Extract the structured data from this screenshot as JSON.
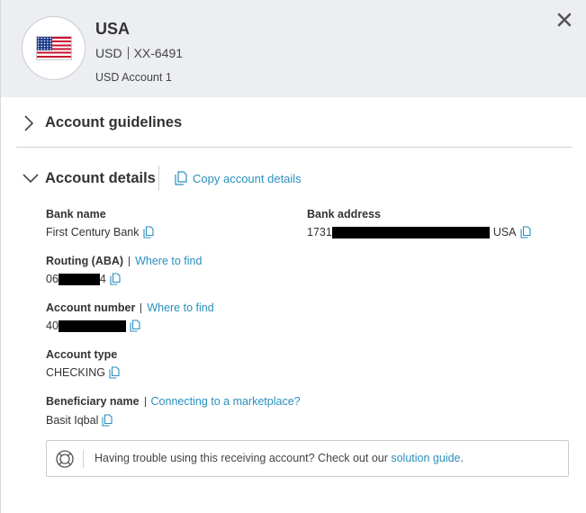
{
  "header": {
    "country": "USA",
    "currency": "USD",
    "account_masked": "XX-6491",
    "account_name": "USD Account 1"
  },
  "sections": {
    "guidelines_title": "Account guidelines",
    "details_title": "Account details",
    "copy_details_label": "Copy account details"
  },
  "fields": {
    "bank_name": {
      "label": "Bank name",
      "value": "First Century Bank"
    },
    "bank_address": {
      "label": "Bank address",
      "value_prefix": "1731",
      "value_suffix": "USA"
    },
    "routing": {
      "label": "Routing (ABA)",
      "link": "Where to find",
      "value_prefix": "06",
      "value_suffix": "4"
    },
    "account_number": {
      "label": "Account number",
      "link": "Where to find",
      "value_prefix": "40"
    },
    "account_type": {
      "label": "Account type",
      "value": "CHECKING"
    },
    "beneficiary": {
      "label": "Beneficiary name",
      "link": "Connecting to a marketplace?",
      "value": "Basit Iqbal"
    }
  },
  "help": {
    "text": "Having trouble using this receiving account? Check out our ",
    "link": "solution guide",
    "end": "."
  },
  "icons": {
    "close": "close-icon",
    "chevron_right": "chevron-right-icon",
    "chevron_down": "chevron-down-icon",
    "copy": "copy-icon",
    "lifebuoy": "lifebuoy-icon",
    "flag": "us-flag-icon"
  },
  "colors": {
    "header_bg": "#eceef1",
    "link": "#2a8fbd",
    "text": "#333333"
  }
}
